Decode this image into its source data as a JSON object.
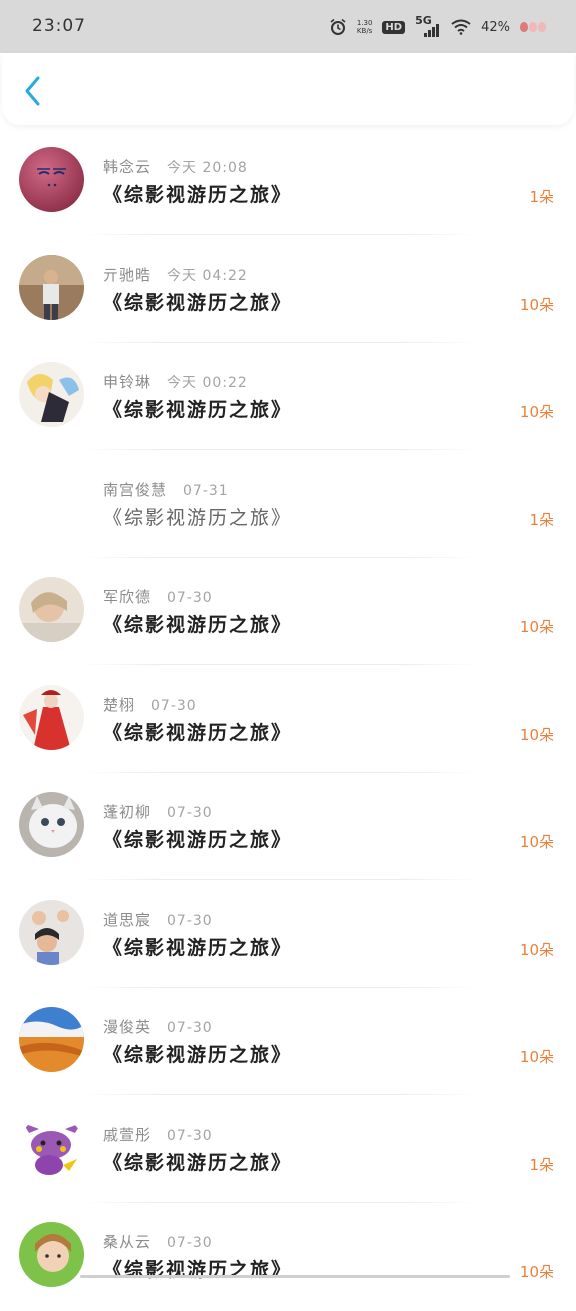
{
  "status_bar": {
    "time": "23:07",
    "net_speed_value": "1.30",
    "net_speed_unit": "KB/s",
    "hd_label": "HD",
    "signal_label": "5G",
    "battery": "42%"
  },
  "colors": {
    "accent": "#29a9e0",
    "amount": "#e8813b",
    "name": "#8c8c8c",
    "title": "#222222"
  },
  "icons": {
    "back": "chevron-left-icon"
  },
  "items": [
    {
      "name": "韩念云",
      "time": "今天 20:08",
      "title": "《综影视游历之旅》",
      "amount": "1朵"
    },
    {
      "name": "亓驰晧",
      "time": "今天 04:22",
      "title": "《综影视游历之旅》",
      "amount": "10朵"
    },
    {
      "name": "申铃琳",
      "time": "今天 00:22",
      "title": "《综影视游历之旅》",
      "amount": "10朵"
    },
    {
      "name": "南宫俊慧",
      "time": "07-31",
      "title": "《综影视游历之旅》",
      "amount": "1朵"
    },
    {
      "name": "军欣德",
      "time": "07-30",
      "title": "《综影视游历之旅》",
      "amount": "10朵"
    },
    {
      "name": "楚栩",
      "time": "07-30",
      "title": "《综影视游历之旅》",
      "amount": "10朵"
    },
    {
      "name": "蓬初柳",
      "time": "07-30",
      "title": "《综影视游历之旅》",
      "amount": "10朵"
    },
    {
      "name": "道思宸",
      "time": "07-30",
      "title": "《综影视游历之旅》",
      "amount": "10朵"
    },
    {
      "name": "漫俊英",
      "time": "07-30",
      "title": "《综影视游历之旅》",
      "amount": "10朵"
    },
    {
      "name": "戚萱彤",
      "time": "07-30",
      "title": "《综影视游历之旅》",
      "amount": "1朵"
    },
    {
      "name": "桑从云",
      "time": "07-30",
      "title": "《综影视游历之旅》",
      "amount": "10朵"
    }
  ]
}
